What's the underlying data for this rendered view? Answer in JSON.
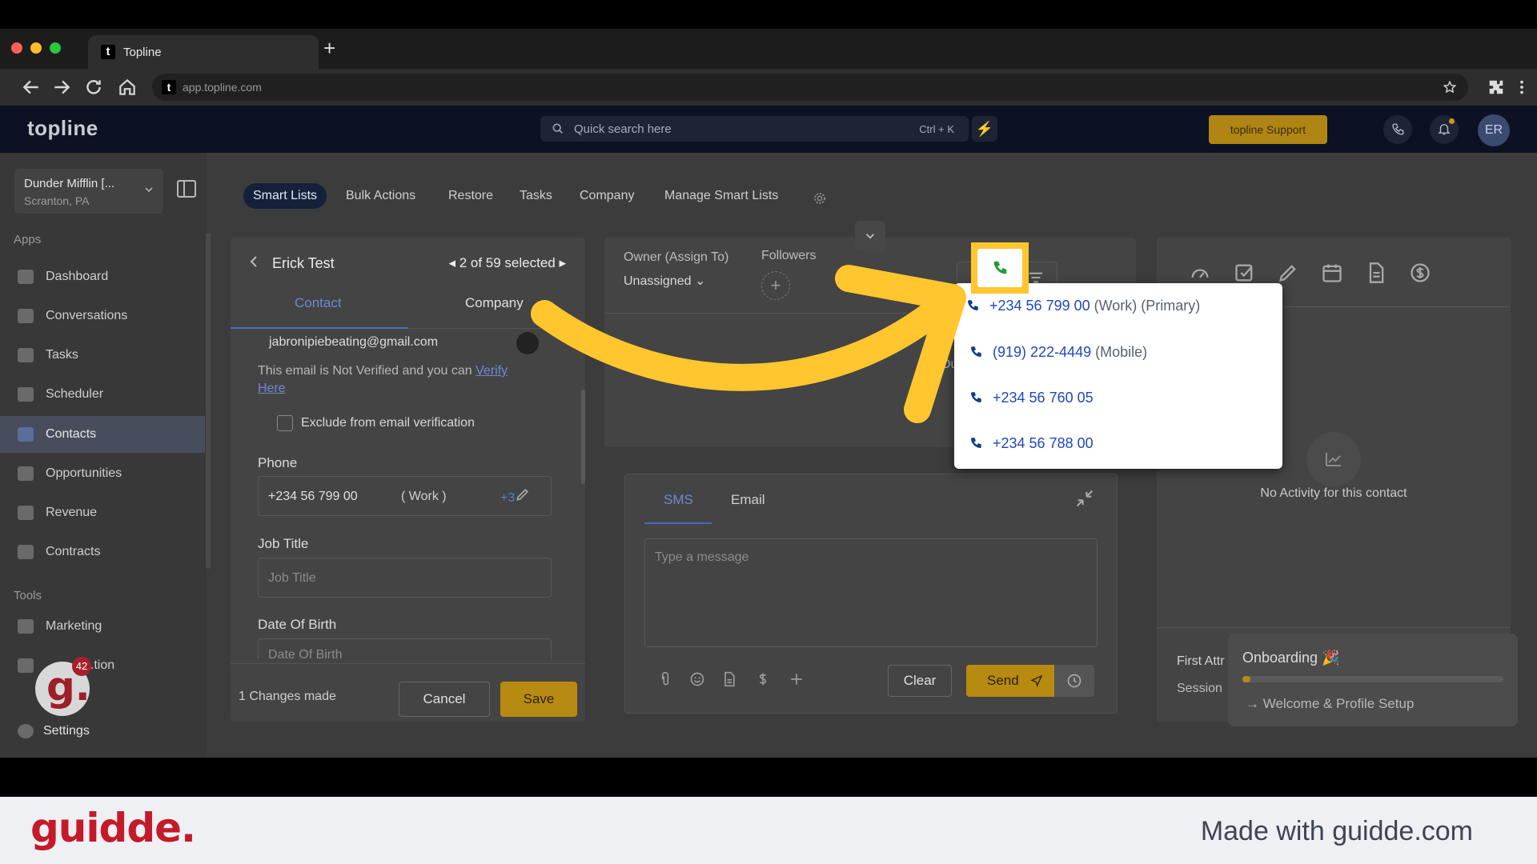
{
  "browser": {
    "tab_title": "Topline",
    "favicon_letter": "t",
    "url": "app.topline.com",
    "new_tab": "+"
  },
  "header": {
    "logo": "topline",
    "search_placeholder": "Quick search here",
    "search_shortcut": "Ctrl + K",
    "support_label": "topline Support",
    "avatar_initials": "ER"
  },
  "sidebar": {
    "location_name": "Dunder Mifflin [...",
    "location_sub": "Scranton, PA",
    "apps_label": "Apps",
    "apps": [
      {
        "label": "Dashboard"
      },
      {
        "label": "Conversations"
      },
      {
        "label": "Tasks"
      },
      {
        "label": "Scheduler"
      },
      {
        "label": "Contacts",
        "active": true
      },
      {
        "label": "Opportunities"
      },
      {
        "label": "Revenue"
      },
      {
        "label": "Contracts"
      }
    ],
    "tools_label": "Tools",
    "tools": [
      {
        "label": "Marketing"
      },
      {
        "label": "...tion"
      },
      {
        "label": "Settings"
      }
    ],
    "guidde_badge": "g.",
    "guidde_count": "42"
  },
  "smartlist_tabs": [
    {
      "label": "Smart Lists",
      "active": true
    },
    {
      "label": "Bulk Actions"
    },
    {
      "label": "Restore"
    },
    {
      "label": "Tasks"
    },
    {
      "label": "Company"
    },
    {
      "label": "Manage Smart Lists"
    }
  ],
  "contact": {
    "name": "Erick Test",
    "selection": "2 of 59 selected",
    "tabs": [
      "Contact",
      "Company"
    ],
    "email": "jabronipiebeating@gmail.com",
    "verify_text": "This email is Not Verified and you can ",
    "verify_link_1": "Verify",
    "verify_link_2": "Here",
    "exclude_label": "Exclude from email verification",
    "phone_label": "Phone",
    "phone_value": "+234 56 799 00",
    "phone_type": "( Work )",
    "phone_more": "+3",
    "job_title_label": "Job Title",
    "job_title_placeholder": "Job Title",
    "dob_label": "Date Of Birth",
    "dob_placeholder": "Date Of Birth",
    "changes": "1 Changes made",
    "cancel": "Cancel",
    "save": "Save"
  },
  "middle": {
    "owner_label": "Owner (Assign To)",
    "owner_value": "Unassigned",
    "followers_label": "Followers",
    "hidden_fragment": "Ou",
    "message_tabs": [
      "SMS",
      "Email"
    ],
    "message_placeholder": "Type a message",
    "clear": "Clear",
    "send": "Send"
  },
  "phone_dropdown": [
    {
      "number": "+234 56 799 00",
      "tag": "(Work) (Primary)"
    },
    {
      "number": "(919) 222-4449",
      "tag": "(Mobile)"
    },
    {
      "number": "+234 56 760 05",
      "tag": ""
    },
    {
      "number": "+234 56 788 00",
      "tag": ""
    }
  ],
  "right": {
    "no_activity": "No Activity for this contact",
    "first_attr": "First Attr",
    "session": "Session"
  },
  "onboarding": {
    "title": "Onboarding 🎉",
    "progress": 0.03,
    "step": "Welcome & Profile Setup"
  },
  "footer": {
    "brand": "guidde.",
    "made_with": "Made with guidde.com"
  },
  "colors": {
    "highlight": "#ffc62e",
    "accent": "#b78a12",
    "link": "#1f47b8",
    "brand_red": "#c41a2a"
  }
}
